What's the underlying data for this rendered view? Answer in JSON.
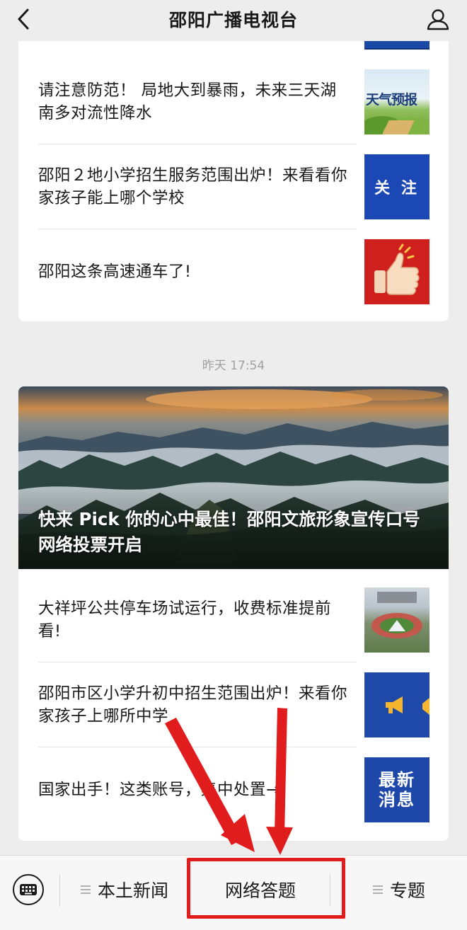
{
  "header": {
    "title": "邵阳广播电视台",
    "back_icon": "chevron-left-icon",
    "profile_icon": "user-icon"
  },
  "top_card": {
    "items": [
      {
        "title": "请注意防范！ 局地大到暴雨，未来三天湖南多对流性降水",
        "thumb_text": "天气预报"
      },
      {
        "title": "邵阳２地小学招生服务范围出炉！来看看你家孩子能上哪个学校",
        "thumb_text": "关 注"
      },
      {
        "title": "邵阳这条高速通车了!",
        "thumb_icon": "thumbs-up-icon"
      }
    ]
  },
  "timestamp": "昨天 17:54",
  "bottom_card": {
    "hero": {
      "title": "快来 Pick 你的心中最佳！邵阳文旅形象宣传口号网络投票开启"
    },
    "items": [
      {
        "title": "大祥坪公共停车场试运行，收费标准提前看!"
      },
      {
        "title": "邵阳市区小学升初中招生范围出炉！来看你家孩子上哪所中学",
        "thumb_icon": "megaphone-icon"
      },
      {
        "title": "国家出手！这类账号，集中处置→",
        "thumb_text": "最新\n消息"
      }
    ]
  },
  "menu": {
    "keyboard_icon": "keyboard-icon",
    "items": [
      {
        "label": "本土新闻",
        "icon": "hamburger-icon"
      },
      {
        "label": "网络答题"
      },
      {
        "label": "专题",
        "icon": "hamburger-icon"
      }
    ]
  },
  "colors": {
    "background": "#ededed",
    "card": "#ffffff",
    "annotation_red": "#e01c1c",
    "follow_blue": "#1c48b5",
    "like_red": "#d0201e"
  }
}
